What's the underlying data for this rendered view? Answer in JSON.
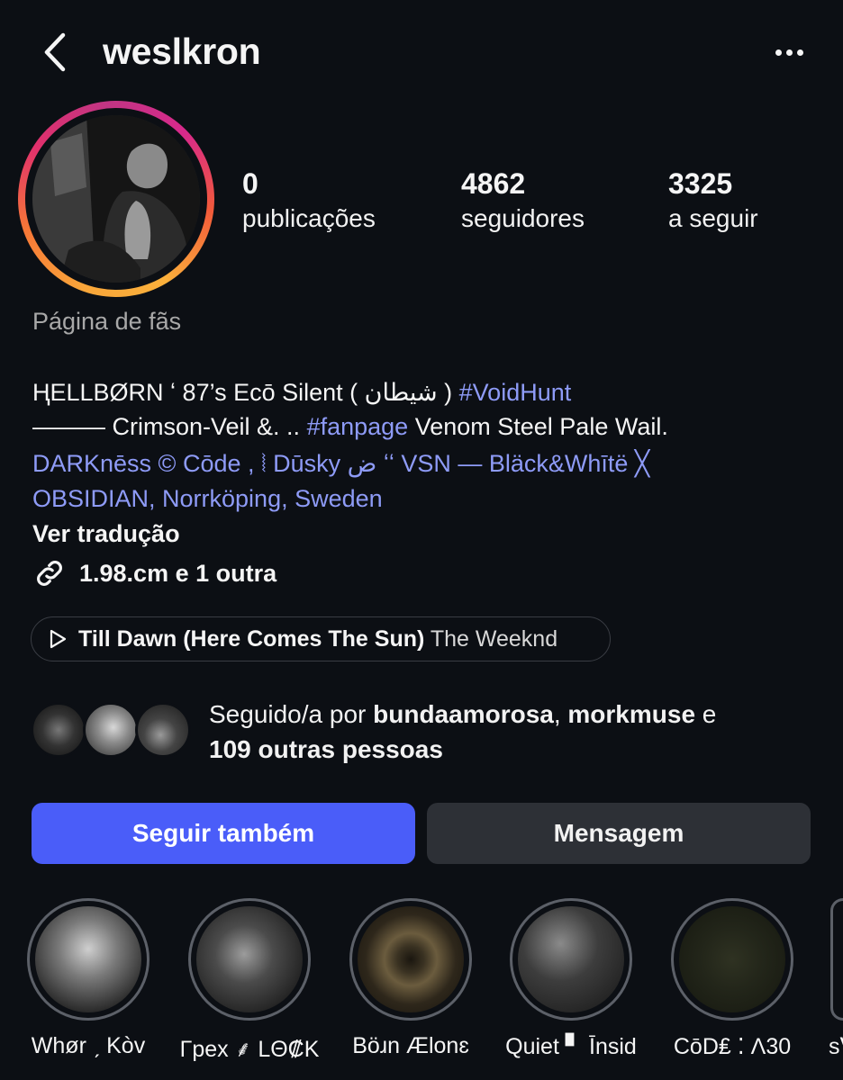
{
  "header": {
    "username": "weslkron",
    "back_icon": "chevron-left-icon",
    "more_icon": "more-horizontal-icon"
  },
  "profile": {
    "stats": [
      {
        "value": "0",
        "label": "publicações"
      },
      {
        "value": "4862",
        "label": "seguidores"
      },
      {
        "value": "3325",
        "label": "a seguir"
      }
    ],
    "category": "Página de fãs"
  },
  "bio": {
    "line1_text": "ⱧELLBØRN ʻ  87’s  Ecō   Silent  ( شيطان ) ",
    "line1_link": "#VoidHunt",
    "line2_text_a": "——— Crimson-Veil &. .. ",
    "line2_link": "#fanpage",
    "line2_text_b": "  Venom  Steel  Pale Wail.",
    "line3_link": "DARKnēss  ©  Cōde  ,  ⦚ Dūsky ض ʻʻ VSN — Bläck&Whītë ╳",
    "line4_link": "OBSIDIAN, Norrköping, Sweden",
    "translate_label": "Ver tradução",
    "link_label": "1.98.cm e 1 outra"
  },
  "music": {
    "title": "Till Dawn (Here Comes The Sun)",
    "artist": "The Weeknd"
  },
  "followed_by": {
    "prefix": "Seguido/a por ",
    "user1": "bundaamorosa",
    "sep": ", ",
    "user2": "morkmuse",
    "conj": " e",
    "others": "109 outras pessoas"
  },
  "buttons": {
    "follow_label": "Seguir também",
    "message_label": "Mensagem",
    "follow_color": "#4a5df9"
  },
  "highlights": [
    {
      "label": "Whør ˏ Kòv"
    },
    {
      "label": "Γpex ⸙ LΘ₡K"
    },
    {
      "label": "Böɹn Ælonɛ"
    },
    {
      "label": "Quiet ▘ Īnsid"
    },
    {
      "label": "CōD₤ ⁚ Λ30"
    },
    {
      "label": "sᐯ"
    }
  ]
}
